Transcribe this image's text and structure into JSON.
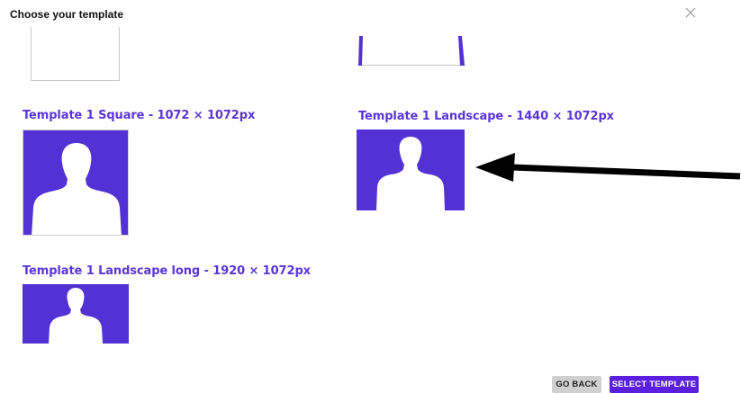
{
  "dialog": {
    "title": "Choose your template",
    "close_icon": "close-icon"
  },
  "templates": [
    {
      "label": "Template 1 Square - 1072 × 1072px",
      "icon": "person-silhouette-icon"
    },
    {
      "label": "Template 1 Landscape - 1440 × 1072px",
      "icon": "person-silhouette-icon"
    },
    {
      "label": "Template 1 Landscape long - 1920 × 1072px",
      "icon": "person-silhouette-icon"
    }
  ],
  "annotation": {
    "icon": "arrow-left-icon"
  },
  "footer": {
    "back_label": "GO BACK",
    "select_label": "SELECT TEMPLATE"
  },
  "colors": {
    "accent": "#5a1fe0",
    "thumbnail": "#5331d4",
    "label": "#5a35d8",
    "secondary_button": "#d0d0d0"
  }
}
